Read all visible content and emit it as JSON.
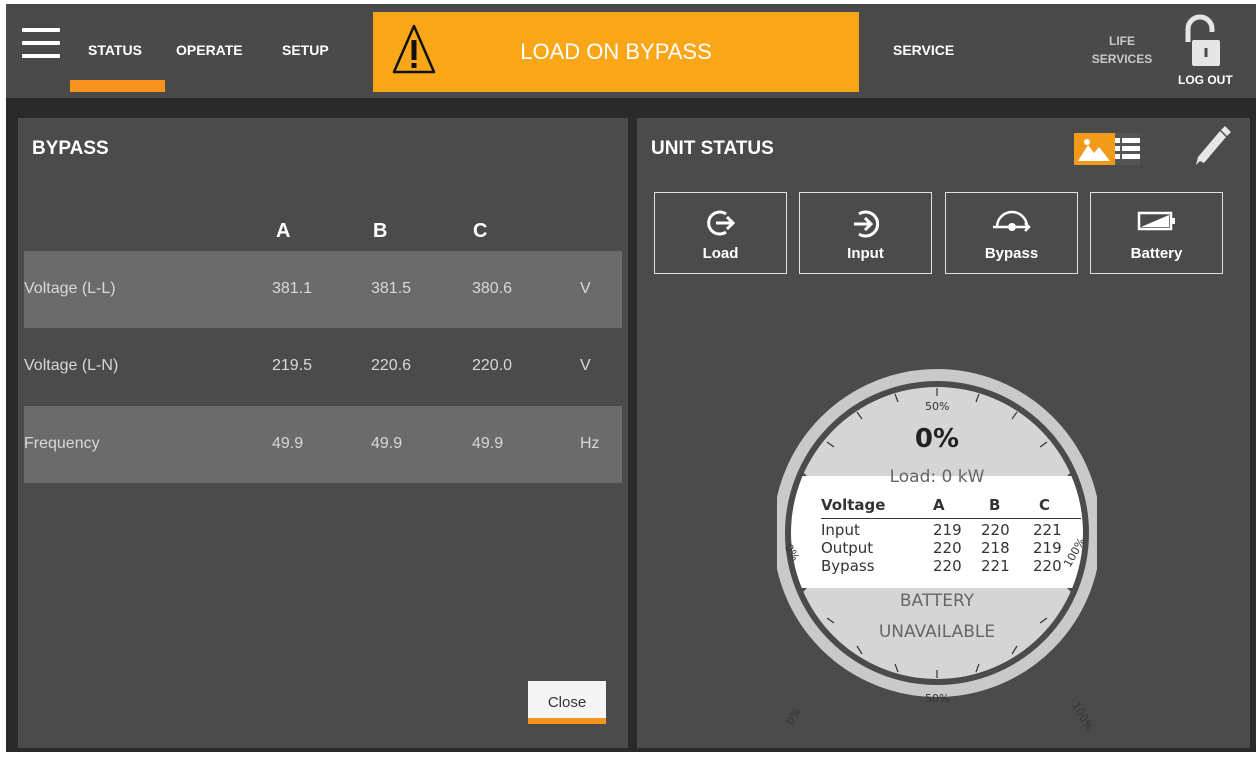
{
  "nav": {
    "status": "STATUS",
    "operate": "OPERATE",
    "setup": "SETUP",
    "alert": "LOAD ON BYPASS",
    "service": "SERVICE",
    "life_services_line1": "LIFE",
    "life_services_line2": "SERVICES",
    "logout": "LOG OUT",
    "accent_color": "#f7941d",
    "alert_color": "#f9a619"
  },
  "bypass": {
    "title": "BYPASS",
    "columns": [
      "A",
      "B",
      "C"
    ],
    "rows": [
      {
        "label": "Voltage (L-L)",
        "a": "381.1",
        "b": "381.5",
        "c": "380.6",
        "unit": "V"
      },
      {
        "label": "Voltage (L-N)",
        "a": "219.5",
        "b": "220.6",
        "c": "220.0",
        "unit": "V"
      },
      {
        "label": "Frequency",
        "a": "49.9",
        "b": "49.9",
        "c": "49.9",
        "unit": "Hz"
      }
    ],
    "close": "Close"
  },
  "unit_status": {
    "title": "UNIT STATUS",
    "tiles": [
      {
        "label": "Load",
        "icon": "load-icon"
      },
      {
        "label": "Input",
        "icon": "input-icon"
      },
      {
        "label": "Bypass",
        "icon": "bypass-icon"
      },
      {
        "label": "Battery",
        "icon": "battery-icon"
      }
    ],
    "gauge": {
      "percent": "0%",
      "load": "Load: 0 kW",
      "top_tick": "50%",
      "bottom_tick": "50%",
      "left_upper_tick": "0%",
      "right_upper_tick": "100%",
      "left_lower_tick": "0%",
      "right_lower_tick": "100%",
      "table_header": [
        "Voltage",
        "A",
        "B",
        "C"
      ],
      "table_rows": [
        [
          "Input",
          "219",
          "220",
          "221"
        ],
        [
          "Output",
          "220",
          "218",
          "219"
        ],
        [
          "Bypass",
          "220",
          "221",
          "220"
        ]
      ],
      "battery_line1": "BATTERY",
      "battery_line2": "UNAVAILABLE"
    }
  }
}
